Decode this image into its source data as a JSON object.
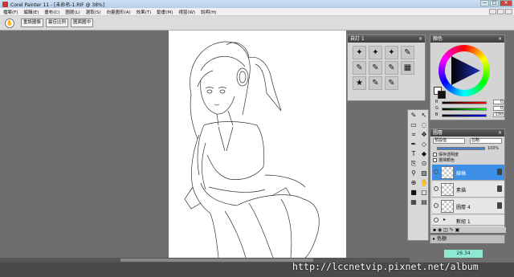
{
  "window": {
    "title": "Corel Painter 11 - [未命名-1.RIF @ 38%]",
    "controls": [
      "—",
      "□",
      "✕"
    ]
  },
  "menu": [
    "檔案(F)",
    "編輯(E)",
    "畫布(C)",
    "圖層(L)",
    "選取(S)",
    "向量圖形(A)",
    "效果(T)",
    "動畫(M)",
    "視窗(W)",
    "說明(H)"
  ],
  "property_bar": {
    "grab_icon": "hand-icon",
    "buttons": [
      "重設圖像",
      "最佳比例",
      "圖面圖中"
    ]
  },
  "custom_palette": {
    "title": "自訂 1",
    "tools": [
      "✦",
      "✦",
      "✦",
      "✎",
      "✎",
      "✎",
      "✎",
      "▦",
      "★",
      "✎",
      "✎",
      ""
    ]
  },
  "colors_palette": {
    "title": "顏色",
    "sliders": [
      {
        "label": "R",
        "value": "0"
      },
      {
        "label": "G",
        "value": "0"
      },
      {
        "label": "B",
        "value": "130"
      }
    ]
  },
  "layers_palette": {
    "title": "圖層",
    "blend_mode": "預設值",
    "composite": "忽略",
    "opacity": "100%",
    "preserve_transparency": "保存透明度",
    "pick_color": "選擇顏色",
    "layers": [
      "線稿",
      "素描",
      "圖層 4",
      "數組 1"
    ]
  },
  "mixer": {
    "title": "色額"
  },
  "status": {
    "zoom_badge": "26.34"
  },
  "watermark": "http://lccnetvip.pixnet.net/album"
}
